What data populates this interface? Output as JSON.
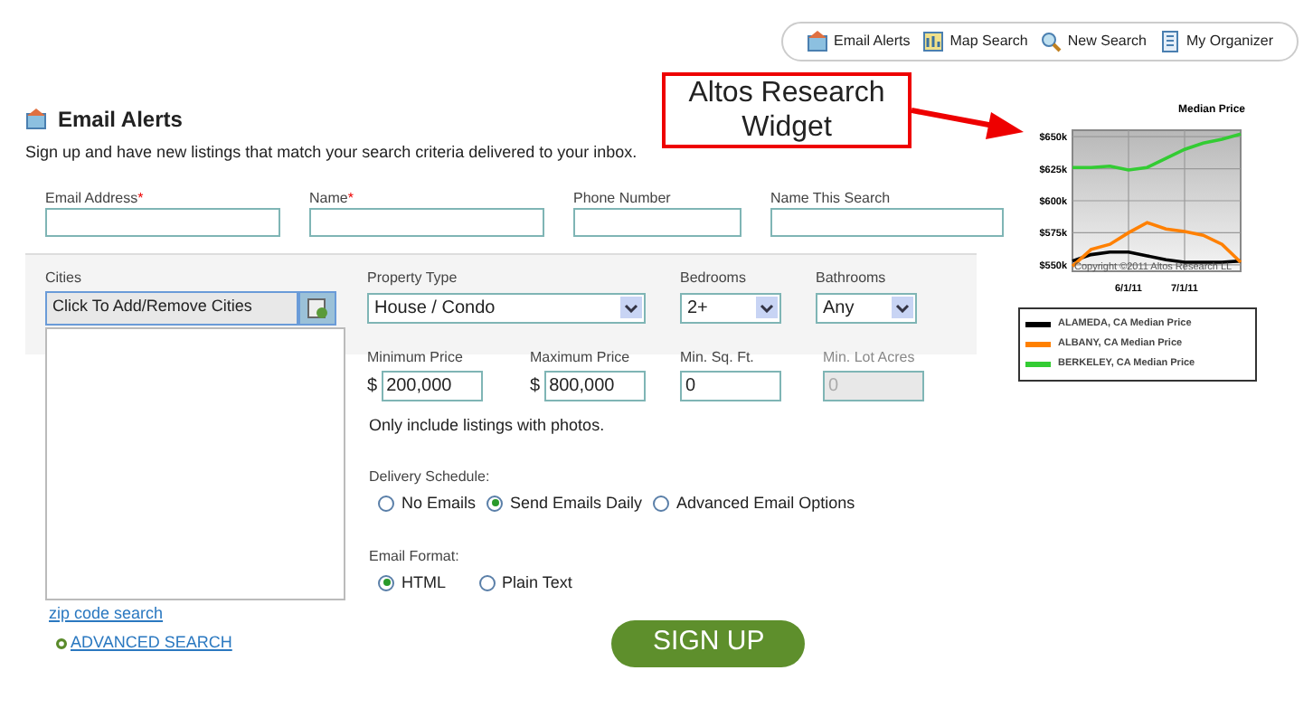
{
  "nav": [
    {
      "label": "Email Alerts",
      "kind": "alerts"
    },
    {
      "label": "Map Search",
      "kind": "map"
    },
    {
      "label": "New Search",
      "kind": "search"
    },
    {
      "label": "My Organizer",
      "kind": "organizer"
    }
  ],
  "header": {
    "title": "Email Alerts",
    "subtitle": "Sign up and have new listings that match your search criteria delivered to your inbox."
  },
  "contact_fields": [
    {
      "label": "Email Address",
      "marker": "*"
    },
    {
      "label": "Name",
      "marker": "*"
    },
    {
      "label": "Phone Number"
    },
    {
      "label": "Name This Search"
    }
  ],
  "cities": {
    "label": "Cities",
    "value": "Click To Add/Remove Cities",
    "link": "zip code search"
  },
  "selects": [
    {
      "label": "Property Type",
      "value": "House / Condo"
    },
    {
      "label": "Bedrooms",
      "value": "2+"
    },
    {
      "label": "Bathrooms",
      "value": "Any"
    }
  ],
  "number_fields": [
    {
      "label": "Minimum Price",
      "prefix": "$",
      "value": "200,000",
      "disabled": false
    },
    {
      "label": "Maximum Price",
      "prefix": "$",
      "value": "800,000",
      "disabled": false
    },
    {
      "label": "Min. Sq. Ft.",
      "value": "0",
      "disabled": false
    },
    {
      "label": "Min. Lot Acres",
      "value": "0",
      "disabled": true
    }
  ],
  "photos_note": "Only include listings with photos.",
  "delivery": {
    "label": "Delivery Schedule:",
    "options": [
      {
        "label": "No Emails",
        "selected": false
      },
      {
        "label": "Send Emails Daily",
        "selected": true
      },
      {
        "label": "Advanced Email Options",
        "selected": false
      }
    ]
  },
  "format": {
    "label": "Email Format:",
    "options": [
      {
        "label": "HTML",
        "selected": true
      },
      {
        "label": "Plain Text",
        "selected": false
      }
    ]
  },
  "advanced_link": "ADVANCED SEARCH",
  "signup": "SIGN UP",
  "callout": "Altos Research Widget",
  "widget": {
    "copyright": "Copyright ©2011 Altos Research LL",
    "chart_data": {
      "type": "line",
      "title": "Median Price",
      "categories": [
        null,
        null,
        null,
        "6/1/11",
        null,
        null,
        "7/1/11",
        null,
        null,
        null
      ],
      "ylim": [
        545,
        655
      ],
      "grid": true,
      "yticks": [
        {
          "value": 550,
          "label": "$550k"
        },
        {
          "value": 575,
          "label": "$575k"
        },
        {
          "value": 600,
          "label": "$600k"
        },
        {
          "value": 625,
          "label": "$625k"
        },
        {
          "value": 650,
          "label": "$650k"
        }
      ],
      "series": [
        {
          "name": "ALAMEDA, CA Median Price",
          "color": "#000000",
          "values": [
            553,
            558,
            560,
            560,
            557,
            554,
            552,
            552,
            552,
            553
          ]
        },
        {
          "name": "ALBANY, CA Median Price",
          "color": "#ff8000",
          "values": [
            549,
            562,
            566,
            575,
            583,
            578,
            576,
            573,
            566,
            552
          ]
        },
        {
          "name": "BERKELEY, CA Median Price",
          "color": "#33cc33",
          "values": [
            626,
            626,
            627,
            624,
            626,
            633,
            640,
            645,
            648,
            652
          ]
        }
      ]
    }
  }
}
